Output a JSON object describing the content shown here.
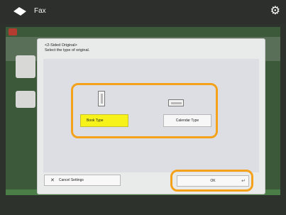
{
  "topbar": {
    "title": "Fax"
  },
  "dialog": {
    "title": "<2-Sided Original>",
    "subtitle": "Select the type of original.",
    "book_type_label": "Book Type",
    "calendar_type_label": "Calendar Type",
    "cancel_label": "Cancel Settings",
    "ok_label": "OK"
  },
  "colors": {
    "highlight": "#f4a21b",
    "selected": "#f6f21a",
    "background": "#1e1f1d"
  }
}
